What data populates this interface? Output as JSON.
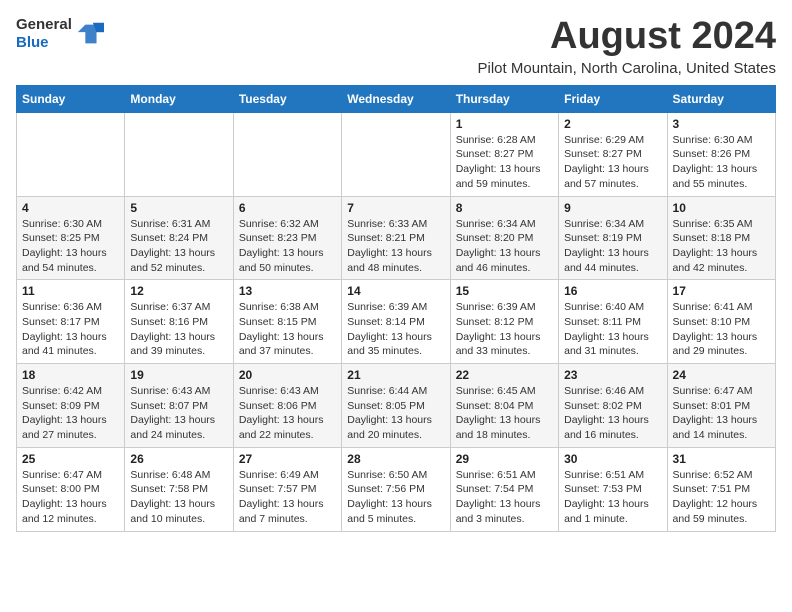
{
  "header": {
    "logo_general": "General",
    "logo_blue": "Blue",
    "title": "August 2024",
    "subtitle": "Pilot Mountain, North Carolina, United States"
  },
  "weekdays": [
    "Sunday",
    "Monday",
    "Tuesday",
    "Wednesday",
    "Thursday",
    "Friday",
    "Saturday"
  ],
  "weeks": [
    [
      {
        "day": "",
        "info": ""
      },
      {
        "day": "",
        "info": ""
      },
      {
        "day": "",
        "info": ""
      },
      {
        "day": "",
        "info": ""
      },
      {
        "day": "1",
        "info": "Sunrise: 6:28 AM\nSunset: 8:27 PM\nDaylight: 13 hours\nand 59 minutes."
      },
      {
        "day": "2",
        "info": "Sunrise: 6:29 AM\nSunset: 8:27 PM\nDaylight: 13 hours\nand 57 minutes."
      },
      {
        "day": "3",
        "info": "Sunrise: 6:30 AM\nSunset: 8:26 PM\nDaylight: 13 hours\nand 55 minutes."
      }
    ],
    [
      {
        "day": "4",
        "info": "Sunrise: 6:30 AM\nSunset: 8:25 PM\nDaylight: 13 hours\nand 54 minutes."
      },
      {
        "day": "5",
        "info": "Sunrise: 6:31 AM\nSunset: 8:24 PM\nDaylight: 13 hours\nand 52 minutes."
      },
      {
        "day": "6",
        "info": "Sunrise: 6:32 AM\nSunset: 8:23 PM\nDaylight: 13 hours\nand 50 minutes."
      },
      {
        "day": "7",
        "info": "Sunrise: 6:33 AM\nSunset: 8:21 PM\nDaylight: 13 hours\nand 48 minutes."
      },
      {
        "day": "8",
        "info": "Sunrise: 6:34 AM\nSunset: 8:20 PM\nDaylight: 13 hours\nand 46 minutes."
      },
      {
        "day": "9",
        "info": "Sunrise: 6:34 AM\nSunset: 8:19 PM\nDaylight: 13 hours\nand 44 minutes."
      },
      {
        "day": "10",
        "info": "Sunrise: 6:35 AM\nSunset: 8:18 PM\nDaylight: 13 hours\nand 42 minutes."
      }
    ],
    [
      {
        "day": "11",
        "info": "Sunrise: 6:36 AM\nSunset: 8:17 PM\nDaylight: 13 hours\nand 41 minutes."
      },
      {
        "day": "12",
        "info": "Sunrise: 6:37 AM\nSunset: 8:16 PM\nDaylight: 13 hours\nand 39 minutes."
      },
      {
        "day": "13",
        "info": "Sunrise: 6:38 AM\nSunset: 8:15 PM\nDaylight: 13 hours\nand 37 minutes."
      },
      {
        "day": "14",
        "info": "Sunrise: 6:39 AM\nSunset: 8:14 PM\nDaylight: 13 hours\nand 35 minutes."
      },
      {
        "day": "15",
        "info": "Sunrise: 6:39 AM\nSunset: 8:12 PM\nDaylight: 13 hours\nand 33 minutes."
      },
      {
        "day": "16",
        "info": "Sunrise: 6:40 AM\nSunset: 8:11 PM\nDaylight: 13 hours\nand 31 minutes."
      },
      {
        "day": "17",
        "info": "Sunrise: 6:41 AM\nSunset: 8:10 PM\nDaylight: 13 hours\nand 29 minutes."
      }
    ],
    [
      {
        "day": "18",
        "info": "Sunrise: 6:42 AM\nSunset: 8:09 PM\nDaylight: 13 hours\nand 27 minutes."
      },
      {
        "day": "19",
        "info": "Sunrise: 6:43 AM\nSunset: 8:07 PM\nDaylight: 13 hours\nand 24 minutes."
      },
      {
        "day": "20",
        "info": "Sunrise: 6:43 AM\nSunset: 8:06 PM\nDaylight: 13 hours\nand 22 minutes."
      },
      {
        "day": "21",
        "info": "Sunrise: 6:44 AM\nSunset: 8:05 PM\nDaylight: 13 hours\nand 20 minutes."
      },
      {
        "day": "22",
        "info": "Sunrise: 6:45 AM\nSunset: 8:04 PM\nDaylight: 13 hours\nand 18 minutes."
      },
      {
        "day": "23",
        "info": "Sunrise: 6:46 AM\nSunset: 8:02 PM\nDaylight: 13 hours\nand 16 minutes."
      },
      {
        "day": "24",
        "info": "Sunrise: 6:47 AM\nSunset: 8:01 PM\nDaylight: 13 hours\nand 14 minutes."
      }
    ],
    [
      {
        "day": "25",
        "info": "Sunrise: 6:47 AM\nSunset: 8:00 PM\nDaylight: 13 hours\nand 12 minutes."
      },
      {
        "day": "26",
        "info": "Sunrise: 6:48 AM\nSunset: 7:58 PM\nDaylight: 13 hours\nand 10 minutes."
      },
      {
        "day": "27",
        "info": "Sunrise: 6:49 AM\nSunset: 7:57 PM\nDaylight: 13 hours\nand 7 minutes."
      },
      {
        "day": "28",
        "info": "Sunrise: 6:50 AM\nSunset: 7:56 PM\nDaylight: 13 hours\nand 5 minutes."
      },
      {
        "day": "29",
        "info": "Sunrise: 6:51 AM\nSunset: 7:54 PM\nDaylight: 13 hours\nand 3 minutes."
      },
      {
        "day": "30",
        "info": "Sunrise: 6:51 AM\nSunset: 7:53 PM\nDaylight: 13 hours\nand 1 minute."
      },
      {
        "day": "31",
        "info": "Sunrise: 6:52 AM\nSunset: 7:51 PM\nDaylight: 12 hours\nand 59 minutes."
      }
    ]
  ]
}
